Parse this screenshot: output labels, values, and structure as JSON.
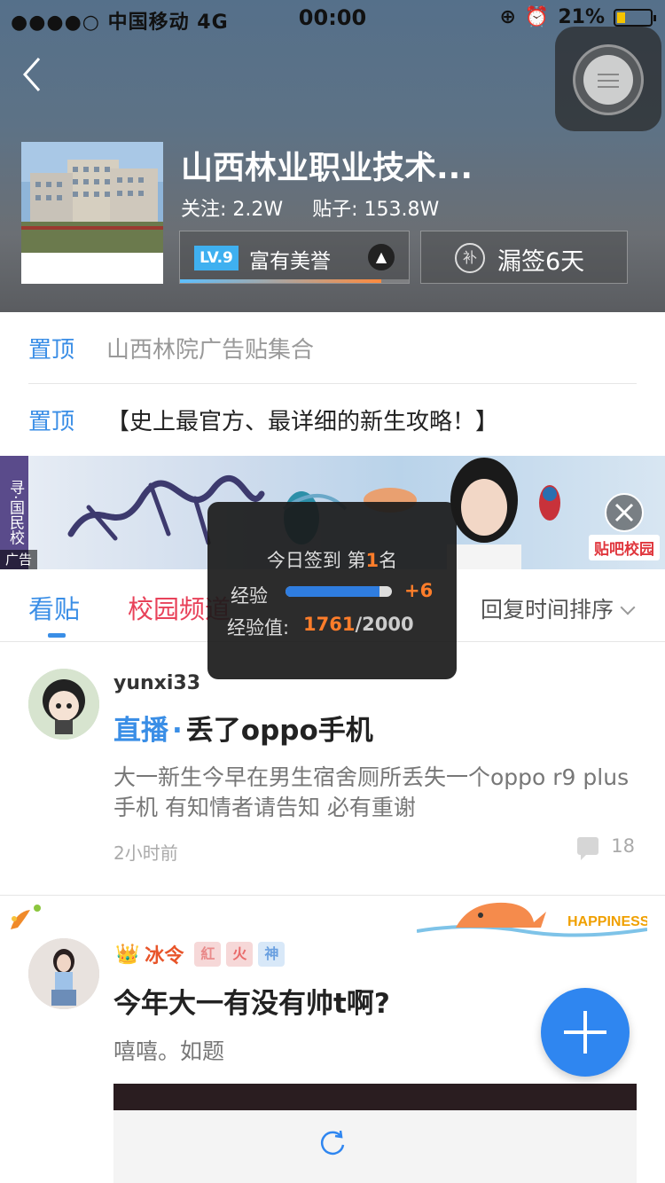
{
  "status_bar": {
    "carrier": "●●●●○ 中国移动  4G",
    "time": "00:00",
    "battery_percent": "21%"
  },
  "forum": {
    "title": "山西林业职业技术...",
    "follow_label": "关注: 2.2W",
    "posts_label": "贴子: 153.8W",
    "level_badge": "LV.9",
    "level_name": "富有美誉",
    "level_progress": 0.88,
    "sign_label": "漏签6天",
    "sign_icon": "补"
  },
  "pinned": [
    {
      "tag": "置顶",
      "text": "山西林院广告贴集合"
    },
    {
      "tag": "置顶",
      "text": "【史上最官方、最详细的新生攻略！】"
    }
  ],
  "ad": {
    "side_text": "寻·国民校",
    "tag": "广告",
    "brand": "贴吧校园"
  },
  "tabs": {
    "posts": "看贴",
    "campus": "校园频道",
    "sort": "回复时间排序"
  },
  "signin_toast": {
    "title_prefix": "今日签到 第",
    "rank": "1",
    "title_suffix": "名",
    "exp_label": "经验",
    "exp_gain": "+6",
    "exp_value_label": "经验值:",
    "exp_current": "1761",
    "exp_total": "/2000",
    "exp_fraction": 0.88
  },
  "posts": [
    {
      "username": "yunxi33",
      "live_tag": "直播",
      "dot": "·",
      "title": "丢了oppo手机",
      "body": "大一新生今早在男生宿舍厕所丢失一个oppo r9 plus手机 有知情者请告知 必有重谢",
      "time": "2小时前",
      "replies": "18"
    },
    {
      "crown": "👑",
      "username": "冰令",
      "badges": [
        "紅",
        "火",
        "神"
      ],
      "title": "今年大一有没有帅t啊?",
      "body": "嘻嘻。如题"
    }
  ],
  "deco_text": "HAPPINESS",
  "colors": {
    "accent_blue": "#3a8ee6",
    "campus_red": "#e8425a",
    "orange": "#ff7d2a",
    "fab_blue": "#2f86f0"
  }
}
